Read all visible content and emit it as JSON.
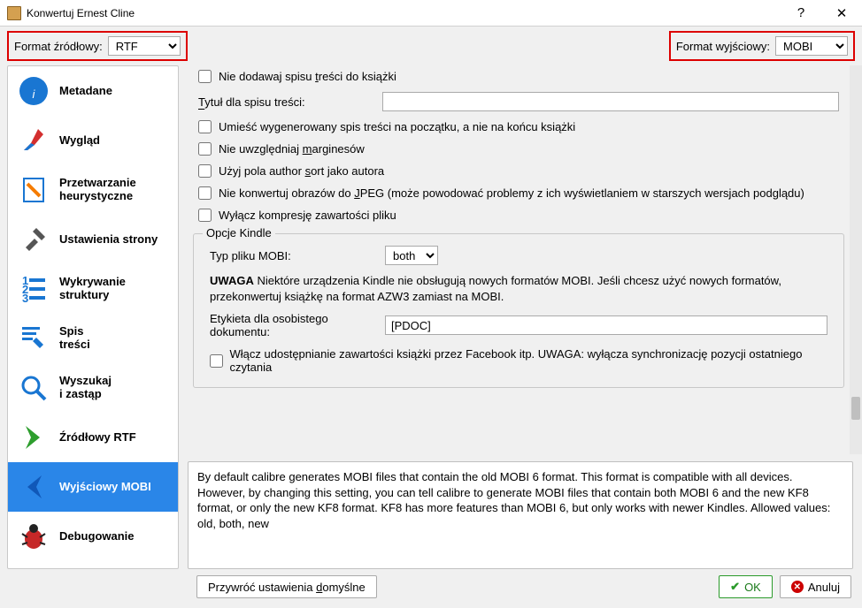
{
  "window": {
    "title": "Konwertuj Ernest Cline"
  },
  "formatbar": {
    "src_label": "Format źródłowy:",
    "src_value": "RTF",
    "dst_label": "Format wyjściowy:",
    "dst_value": "MOBI"
  },
  "sidebar": {
    "items": [
      {
        "label": "Metadane"
      },
      {
        "label": "Wygląd"
      },
      {
        "label": "Przetwarzanie heurystyczne"
      },
      {
        "label": "Ustawienia strony"
      },
      {
        "label": "Wykrywanie struktury"
      },
      {
        "label": "Spis\ntreści"
      },
      {
        "label": "Wyszukaj\ni zastąp"
      },
      {
        "label": "Źródłowy RTF"
      },
      {
        "label": "Wyjściowy MOBI"
      },
      {
        "label": "Debugowanie"
      }
    ]
  },
  "options": {
    "no_toc": "Nie dodawaj spisu treści do książki",
    "toc_title_label": "Tytuł dla spisu treści:",
    "toc_title_value": "",
    "toc_at_start": "Umieść wygenerowany spis treści na początku, a nie na końcu książki",
    "ignore_margins": "Nie uwzględniaj marginesów",
    "author_sort": "Użyj pola author sort jako autora",
    "no_jpeg": "Nie konwertuj obrazów do JPEG (może powodować problemy z ich wyświetlaniem w starszych wersjach podglądu)",
    "disable_compress": "Wyłącz kompresję zawartości pliku"
  },
  "kindle": {
    "group_title": "Opcje Kindle",
    "mobi_type_label": "Typ pliku MOBI:",
    "mobi_type_value": "both",
    "warning_b": "UWAGA",
    "warning_rest": " Niektóre urządzenia Kindle nie obsługują nowych formatów MOBI. Jeśli chcesz użyć nowych formatów, przekonwertuj książkę na format AZW3 zamiast na MOBI.",
    "pdoc_label": "Etykieta dla osobistego dokumentu:",
    "pdoc_value": "[PDOC]",
    "fb_share": "Włącz udostępnianie zawartości książki przez Facebook itp. UWAGA: wyłącza synchronizację pozycji ostatniego czytania"
  },
  "help": {
    "text": "By default calibre generates MOBI files that contain the old MOBI 6 format. This format is compatible with all devices. However, by changing this setting, you can tell calibre to generate MOBI files that contain both MOBI 6 and the new KF8 format, or only the new KF8 format. KF8 has more features than MOBI 6, but only works with newer Kindles. Allowed values: old, both, new"
  },
  "footer": {
    "restore": "Przywróć ustawienia domyślne",
    "ok": "OK",
    "cancel": "Anuluj"
  }
}
